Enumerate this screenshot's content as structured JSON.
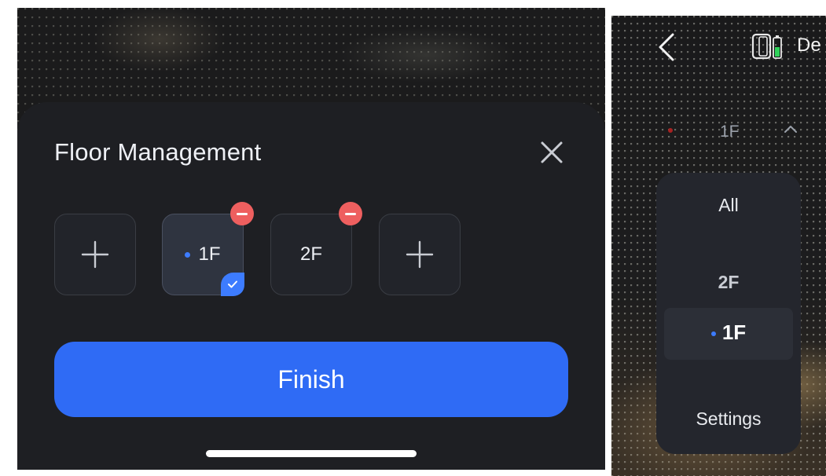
{
  "floor_sheet": {
    "title": "Floor Management",
    "floors": [
      {
        "label": "1F",
        "selected": true
      },
      {
        "label": "2F",
        "selected": false
      }
    ],
    "finish_label": "Finish",
    "colors": {
      "accent": "#2f6bf5",
      "remove": "#ee5f5f",
      "sheet_bg": "#1e1f23"
    }
  },
  "map_view": {
    "device_name": "De",
    "current_floor": "1F",
    "dropdown": {
      "items": [
        "All",
        "2F",
        "1F",
        "Settings"
      ],
      "selected": "1F"
    }
  }
}
